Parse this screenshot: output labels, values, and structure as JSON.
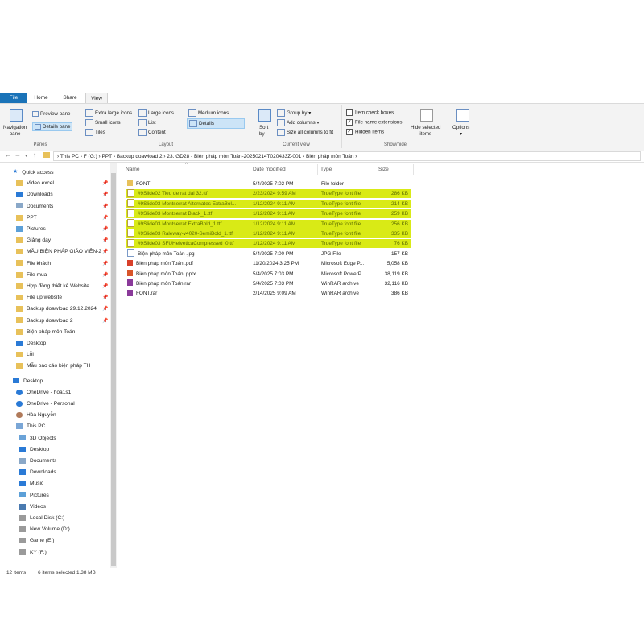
{
  "ribbon": {
    "tabs": [
      "File",
      "Home",
      "Share",
      "View"
    ],
    "panes": {
      "label": "Panes",
      "nav_pane": "Navigation\npane",
      "preview_pane": "Preview pane",
      "details_pane": "Details pane"
    },
    "layout": {
      "label": "Layout",
      "items": [
        "Extra large icons",
        "Large icons",
        "Medium icons",
        "Small icons",
        "List",
        "Details",
        "Tiles",
        "Content"
      ]
    },
    "current_view": {
      "label": "Current view",
      "sort_by": "Sort\nby",
      "group_by": "Group by",
      "add_columns": "Add columns",
      "size_all": "Size all columns to fit"
    },
    "show_hide": {
      "label": "Show/hide",
      "item_check": "Item check boxes",
      "file_ext": "File name extensions",
      "hidden": "Hidden items",
      "hide_selected": "Hide selected\nitems"
    },
    "options": "Options"
  },
  "address": {
    "crumbs": [
      "This PC",
      "F (G:)",
      "PPT",
      "Backup doawload 2",
      "23. GD28 - Biện pháp môn Toán-20250214T020433Z-001",
      "Biện pháp môn Toán"
    ]
  },
  "nav": [
    {
      "label": "Quick access",
      "icon": "star-icon",
      "indent": 0
    },
    {
      "label": "Video excel",
      "icon": "folder-icon",
      "indent": 1,
      "pin": true
    },
    {
      "label": "Downloads",
      "icon": "download-icon",
      "indent": 1,
      "pin": true
    },
    {
      "label": "Documents",
      "icon": "documents-icon",
      "indent": 1,
      "pin": true
    },
    {
      "label": "PPT",
      "icon": "folder-icon",
      "indent": 1,
      "pin": true
    },
    {
      "label": "Pictures",
      "icon": "pictures-icon",
      "indent": 1,
      "pin": true
    },
    {
      "label": "Giảng dạy",
      "icon": "folder-icon",
      "indent": 1,
      "pin": true
    },
    {
      "label": "MẪU BIỆN PHÁP GIÁO VIÊN-2",
      "icon": "folder-icon",
      "indent": 1,
      "pin": true
    },
    {
      "label": "File khách",
      "icon": "folder-icon",
      "indent": 1,
      "pin": true
    },
    {
      "label": "File mua",
      "icon": "folder-icon",
      "indent": 1,
      "pin": true
    },
    {
      "label": "Hợp đồng thiết kế Website",
      "icon": "folder-icon",
      "indent": 1,
      "pin": true
    },
    {
      "label": "File up website",
      "icon": "folder-icon",
      "indent": 1,
      "pin": true
    },
    {
      "label": "Backup doawload 29.12.2024",
      "icon": "folder-icon",
      "indent": 1,
      "pin": true
    },
    {
      "label": "Backup doawload 2",
      "icon": "folder-icon",
      "indent": 1,
      "pin": true
    },
    {
      "label": "Biện pháp môn Toán",
      "icon": "folder-icon",
      "indent": 1,
      "pin": false
    },
    {
      "label": "Desktop",
      "icon": "desktop-icon",
      "indent": 1,
      "pin": false
    },
    {
      "label": "Lỗi",
      "icon": "folder-icon",
      "indent": 1,
      "pin": false
    },
    {
      "label": "Mẫu báo cáo biện pháp TH",
      "icon": "folder-icon",
      "indent": 1,
      "pin": false
    },
    {
      "label": "Desktop",
      "icon": "desktop-icon",
      "indent": 0,
      "gap": true
    },
    {
      "label": "OneDrive - hoa1s1",
      "icon": "cloud-icon",
      "indent": 1
    },
    {
      "label": "OneDrive - Personal",
      "icon": "cloud-icon",
      "indent": 1
    },
    {
      "label": "Hòa Nguyễn",
      "icon": "user-icon",
      "indent": 1
    },
    {
      "label": "This PC",
      "icon": "computer-icon",
      "indent": 1
    },
    {
      "label": "3D Objects",
      "icon": "cube-icon",
      "indent": 2
    },
    {
      "label": "Desktop",
      "icon": "desktop-icon",
      "indent": 2
    },
    {
      "label": "Documents",
      "icon": "documents-icon",
      "indent": 2
    },
    {
      "label": "Downloads",
      "icon": "download-icon",
      "indent": 2
    },
    {
      "label": "Music",
      "icon": "music-icon",
      "indent": 2
    },
    {
      "label": "Pictures",
      "icon": "pictures-icon",
      "indent": 2
    },
    {
      "label": "Videos",
      "icon": "video-icon",
      "indent": 2
    },
    {
      "label": "Local Disk (C:)",
      "icon": "drive-icon",
      "indent": 2
    },
    {
      "label": "New Volume (D:)",
      "icon": "drive-icon",
      "indent": 2
    },
    {
      "label": "Game (E:)",
      "icon": "drive-icon",
      "indent": 2
    },
    {
      "label": "KY (F:)",
      "icon": "drive-icon",
      "indent": 2
    }
  ],
  "columns": {
    "name": "Name",
    "date": "Date modified",
    "type": "Type",
    "size": "Size"
  },
  "files": [
    {
      "name": "FONT",
      "date": "5/4/2025 7:02 PM",
      "type": "File folder",
      "size": "",
      "icon": "folder-icon",
      "highlight": false
    },
    {
      "name": "#9Slide02 Tieu de rat dai 32.ttf",
      "date": "2/23/2024 9:59 AM",
      "type": "TrueType font file",
      "size": "286 KB",
      "icon": "font-file-icon",
      "highlight": true
    },
    {
      "name": "#9Slide03 Montserrat Alternates ExtraBol...",
      "date": "1/12/2024 9:11 AM",
      "type": "TrueType font file",
      "size": "214 KB",
      "icon": "font-file-icon",
      "highlight": true
    },
    {
      "name": "#9Slide03 Montserrat Black_1.ttf",
      "date": "1/12/2024 9:11 AM",
      "type": "TrueType font file",
      "size": "259 KB",
      "icon": "font-file-icon",
      "highlight": true
    },
    {
      "name": "#9Slide03 Montserrat ExtraBold_1.ttf",
      "date": "1/12/2024 9:11 AM",
      "type": "TrueType font file",
      "size": "256 KB",
      "icon": "font-file-icon",
      "highlight": true
    },
    {
      "name": "#9Slide03 Raleway-v4020-SemiBold_1.ttf",
      "date": "1/12/2024 9:11 AM",
      "type": "TrueType font file",
      "size": "335 KB",
      "icon": "font-file-icon",
      "highlight": true
    },
    {
      "name": "#9Slide03 SFUHelveticaCompressed_0.ttf",
      "date": "1/12/2024 9:11 AM",
      "type": "TrueType font file",
      "size": "76 KB",
      "icon": "font-file-icon",
      "highlight": true
    },
    {
      "name": "Biện pháp môn Toán .jpg",
      "date": "5/4/2025 7:00 PM",
      "type": "JPG File",
      "size": "157 KB",
      "icon": "image-file-icon",
      "highlight": false
    },
    {
      "name": "Biện pháp môn Toán .pdf",
      "date": "11/20/2024 3:25 PM",
      "type": "Microsoft Edge P...",
      "size": "5,058 KB",
      "icon": "pdf-file-icon",
      "highlight": false
    },
    {
      "name": "Biện pháp môn Toán .pptx",
      "date": "5/4/2025 7:03 PM",
      "type": "Microsoft PowerP...",
      "size": "38,119 KB",
      "icon": "pptx-file-icon",
      "highlight": false
    },
    {
      "name": "Biện pháp môn Toán.rar",
      "date": "5/4/2025 7:03 PM",
      "type": "WinRAR archive",
      "size": "32,116 KB",
      "icon": "rar-file-icon",
      "highlight": false
    },
    {
      "name": "FONT.rar",
      "date": "2/14/2025 9:09 AM",
      "type": "WinRAR archive",
      "size": "386 KB",
      "icon": "rar-file-icon",
      "highlight": false
    }
  ],
  "status": {
    "items": "12 items",
    "selected": "6 items selected  1.38 MB"
  },
  "colors": {
    "highlight": "#d9ea16",
    "folder": "#e8c15a",
    "file_tab": "#1a73b8"
  }
}
